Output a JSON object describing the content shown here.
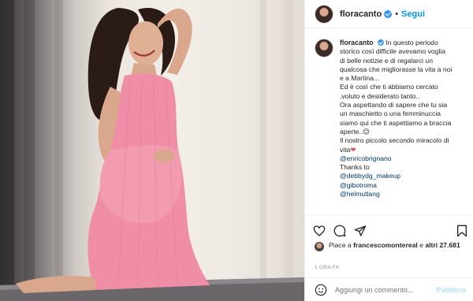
{
  "post": {
    "username": "floracanto",
    "follow_label": "Segui",
    "separator": "•"
  },
  "caption": {
    "lines": [
      "In questo periodo",
      "storico così difficile avevamo voglia",
      "di belle notizie e di regalarci un",
      "qualcosa che migliorasse la vita a noi",
      "e a Martina...",
      "Ed è così che ti abbiamo cercato",
      ",voluto e desiderato tanto..",
      "Ora aspettando di sapere che tu sia",
      "un maschietto o una femminuccia",
      "siamo qui che ti aspettiamo a braccia",
      "aperte..😉",
      "Il nostro piccolo secondo miracolo di",
      "vita"
    ],
    "heart": "❤",
    "mention_1": "@enricobrignano",
    "thanks": "Thanks to",
    "mentions": [
      "@debbydg_makeup",
      "@gibotroma",
      "@helmutlang"
    ]
  },
  "likes": {
    "prefix": "Piace a",
    "user": "francescomontereal",
    "joiner": "e",
    "others": "altri 27.681"
  },
  "timestamp": "1 ORA FA",
  "comment": {
    "placeholder": "Aggiungi un commento...",
    "publish_label": "Pubblica"
  },
  "colors": {
    "link": "#00376b",
    "follow": "#0095f6",
    "verified": "#3897f0",
    "dress": "#ef8ea6",
    "publish_disabled": "#b2dffc"
  },
  "icons": [
    "heart-icon",
    "comment-icon",
    "share-icon",
    "bookmark-icon",
    "smiley-icon",
    "verified-badge-icon"
  ]
}
